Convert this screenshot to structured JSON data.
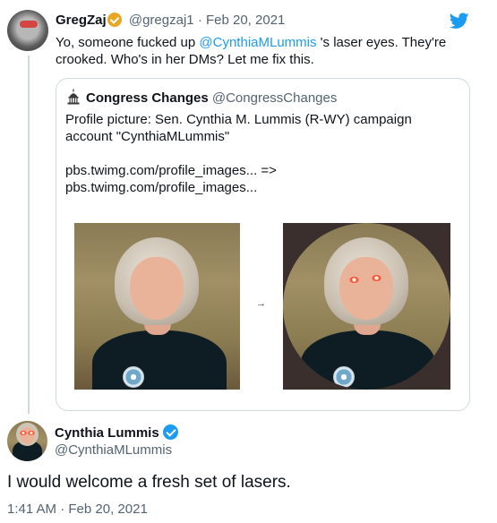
{
  "tweet1": {
    "name": "GregZaj",
    "handle": "@gregzaj1",
    "separator": "·",
    "date": "Feb 20, 2021",
    "text_before": "Yo, someone fucked up ",
    "mention": "@CynthiaMLummis",
    "text_after": " 's laser eyes. They're",
    "text_line2": "crooked.  Who's in her DMs?  Let me fix this.",
    "avatar_icon": "avatar-laser-eyes",
    "verified_icon": "gold-check-badge",
    "logo_icon": "twitter-bird-icon"
  },
  "quote": {
    "name": "Congress Changes",
    "handle": "@CongressChanges",
    "icon": "capitol-dome-icon",
    "line1": "Profile picture: Sen. Cynthia M. Lummis (R-WY) campaign",
    "line2": "account \"CynthiaMLummis\"",
    "line3": "pbs.twimg.com/profile_images... =>",
    "line4": "pbs.twimg.com/profile_images...",
    "arrow": "→"
  },
  "tweet2": {
    "name": "Cynthia Lummis",
    "handle": "@CynthiaMLummis",
    "verified_icon": "blue-check-badge",
    "text": "I would welcome a fresh set of lasers.",
    "time": "1:41 AM",
    "separator": "·",
    "date": "Feb 20, 2021"
  },
  "colors": {
    "link": "#1d9bf0",
    "muted": "#536471",
    "text": "#0f1419",
    "border": "#cfd9de"
  }
}
